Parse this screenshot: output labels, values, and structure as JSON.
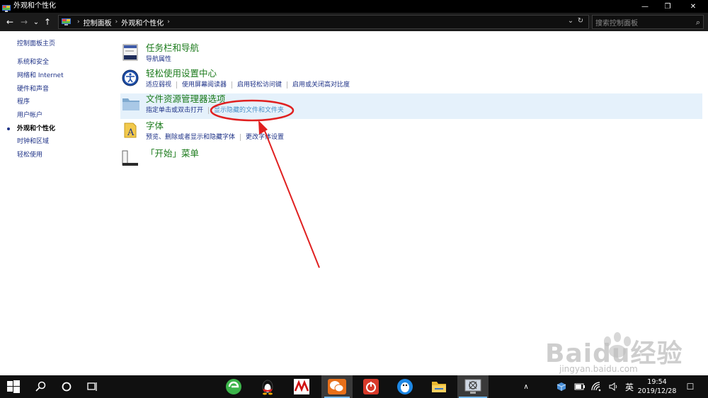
{
  "window": {
    "title": "外观和个性化",
    "minimize_glyph": "—",
    "maximize_glyph": "❐",
    "close_glyph": "✕"
  },
  "address": {
    "back_glyph": "←",
    "forward_glyph": "→",
    "recent_glyph": "⌄",
    "up_glyph": "↑",
    "sep_glyph": "›",
    "crumbs": [
      "控制面板",
      "外观和个性化"
    ],
    "dropdown_glyph": "⌄",
    "refresh_glyph": "↻",
    "search_placeholder": "搜索控制面板",
    "search_glyph": "⌕"
  },
  "sidebar": {
    "items": [
      {
        "label": "控制面板主页"
      },
      {
        "label": "系统和安全"
      },
      {
        "label": "网络和 Internet"
      },
      {
        "label": "硬件和声音"
      },
      {
        "label": "程序"
      },
      {
        "label": "用户帐户"
      },
      {
        "label": "外观和个性化"
      },
      {
        "label": "时钟和区域"
      },
      {
        "label": "轻松使用"
      }
    ]
  },
  "categories": [
    {
      "title": "任务栏和导航",
      "links": [
        "导航属性"
      ]
    },
    {
      "title": "轻松使用设置中心",
      "links": [
        "适应弱视",
        "使用屏幕阅读器",
        "启用轻松访问键",
        "启用或关闭高对比度"
      ]
    },
    {
      "title": "文件资源管理器选项",
      "links": [
        "指定单击或双击打开",
        "显示隐藏的文件和文件夹"
      ]
    },
    {
      "title": "字体",
      "links": [
        "预览、删除或者显示和隐藏字体",
        "更改字体设置"
      ]
    },
    {
      "title": "「开始」菜单",
      "links": []
    }
  ],
  "watermark": {
    "text": "Baidu经验",
    "sub": "jingyan.baidu.com"
  },
  "taskbar": {
    "time": "19:54",
    "date": "2019/12/28",
    "ime": "英",
    "tray_up_glyph": "∧",
    "notification_glyph": "☐"
  },
  "colors": {
    "title_green": "#1a7a1a",
    "link_blue": "#1e3287",
    "highlight": "#e5f1fb",
    "annotation_red": "#e02020"
  }
}
